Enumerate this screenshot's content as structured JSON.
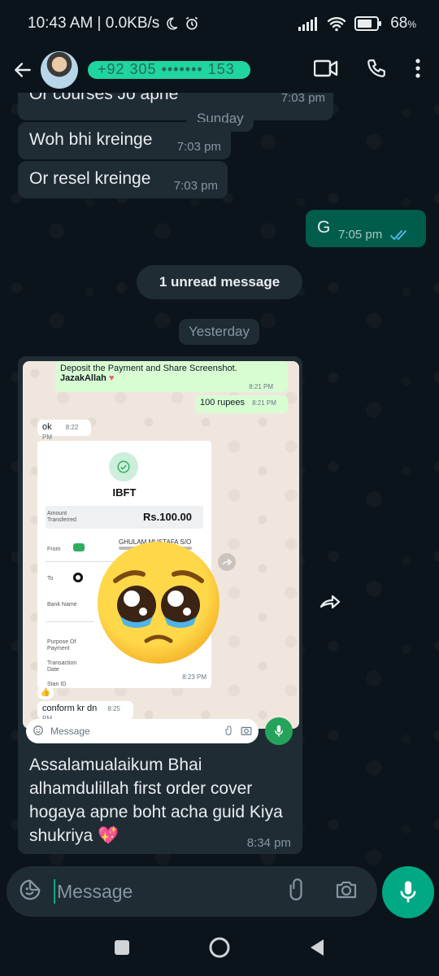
{
  "status_bar": {
    "time_speed": "10:43 AM | 0.0KB/s",
    "battery": "68"
  },
  "header": {
    "contact_name_masked": "+92 305 ••••••• 153"
  },
  "messages": [
    {
      "text": "Or courses Jo apne ",
      "time": "7:03 pm"
    },
    {
      "text": "Woh bhi kreinge",
      "time": "7:03 pm"
    },
    {
      "text": "Or resel kreinge",
      "time": "7:03 pm"
    },
    {
      "text": "G",
      "time": "7:05 pm"
    }
  ],
  "date_pills": {
    "sunday": "Sunday",
    "yesterday": "Yesterday"
  },
  "unread_banner": "1 unread message",
  "image_message": {
    "screenshot": {
      "msg1_line1": "Deposit the Payment and Share Screenshot.",
      "msg1_line2": "JazakAllah",
      "msg1_time": "8:21 PM",
      "msg2_text": "100 rupees",
      "msg2_time": "8:21 PM",
      "msg3_text": "ok",
      "msg3_time": "8:22 PM",
      "receipt": {
        "title": "IBFT",
        "amount_label": "Amount Transferred",
        "amount_value": "Rs.100.00",
        "from_label": "From",
        "from_value": "GHULAM MUSTAFA S/O",
        "to_label": "To",
        "bank_label": "Bank Name",
        "purpose_label": "Purpose Of Payment",
        "transaction_label": "Transaction Date",
        "stan_label": "Stan ID",
        "time": "8:23 PM"
      },
      "msg4_text": "conform kr dn",
      "msg4_time": "8:25 PM",
      "input_placeholder": "Message"
    },
    "caption": "Assalamualaikum Bhai alhamdulillah first order cover hogaya apne boht acha guid Kiya shukriya",
    "time": "8:34 pm"
  },
  "input": {
    "placeholder": "Message"
  },
  "colors": {
    "background": "#0b141a",
    "incoming_bubble": "#1f2c34",
    "outgoing_bubble": "#005c4b",
    "accent": "#00a884"
  }
}
